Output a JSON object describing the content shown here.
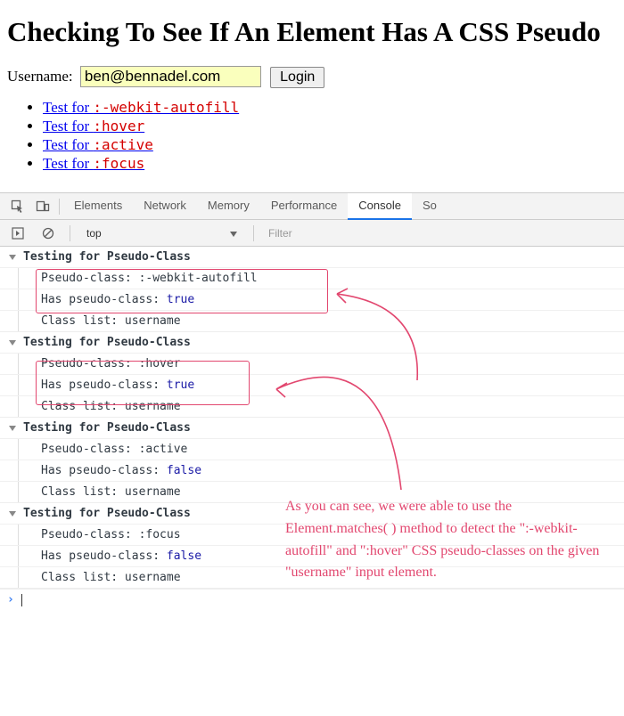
{
  "page": {
    "title": "Checking To See If An Element Has A CSS Pseudo",
    "username_label": "Username:",
    "username_value": "ben@bennadel.com",
    "login_label": "Login",
    "test_prefix": "Test for ",
    "tests": [
      {
        "pseudo": ":-webkit-autofill"
      },
      {
        "pseudo": ":hover"
      },
      {
        "pseudo": ":active"
      },
      {
        "pseudo": ":focus"
      }
    ]
  },
  "devtools": {
    "tabs": {
      "elements": "Elements",
      "network": "Network",
      "memory": "Memory",
      "performance": "Performance",
      "console": "Console",
      "sources": "So"
    },
    "context": "top",
    "filter_placeholder": "Filter",
    "groups": [
      {
        "header": "Testing for Pseudo-Class",
        "rows": [
          {
            "label": "Pseudo-class:",
            "value": ":-webkit-autofill",
            "kind": "text"
          },
          {
            "label": "Has pseudo-class:",
            "value": "true",
            "kind": "bool"
          },
          {
            "label": "Class list:",
            "value": "username",
            "kind": "text"
          }
        ]
      },
      {
        "header": "Testing for Pseudo-Class",
        "rows": [
          {
            "label": "Pseudo-class:",
            "value": ":hover",
            "kind": "text"
          },
          {
            "label": "Has pseudo-class:",
            "value": "true",
            "kind": "bool"
          },
          {
            "label": "Class list:",
            "value": "username",
            "kind": "text"
          }
        ]
      },
      {
        "header": "Testing for Pseudo-Class",
        "rows": [
          {
            "label": "Pseudo-class:",
            "value": ":active",
            "kind": "text"
          },
          {
            "label": "Has pseudo-class:",
            "value": "false",
            "kind": "bool"
          },
          {
            "label": "Class list:",
            "value": "username",
            "kind": "text"
          }
        ]
      },
      {
        "header": "Testing for Pseudo-Class",
        "rows": [
          {
            "label": "Pseudo-class:",
            "value": ":focus",
            "kind": "text"
          },
          {
            "label": "Has pseudo-class:",
            "value": "false",
            "kind": "bool"
          },
          {
            "label": "Class list:",
            "value": "username",
            "kind": "text"
          }
        ]
      }
    ]
  },
  "annotation": {
    "text": "As you can see, we were able to use the Element.matches( ) method to detect the \":-webkit-autofill\" and \":hover\" CSS pseudo-classes on the given \"username\" input element."
  }
}
